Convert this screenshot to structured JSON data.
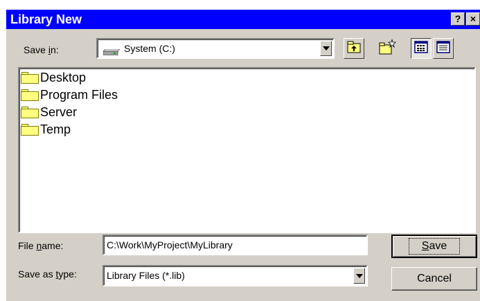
{
  "window": {
    "title": "Library New",
    "help_label": "?",
    "close_label": "×"
  },
  "save_in": {
    "label_pre": "Save ",
    "label_key": "i",
    "label_post": "n:",
    "value": "System (C:)",
    "icon": "hard-drive-icon"
  },
  "toolbar": {
    "icons": [
      "up-one-level-icon",
      "create-new-folder-icon",
      "list-view-icon",
      "details-view-icon"
    ]
  },
  "files": [
    {
      "name": "Desktop",
      "icon": "folder-icon"
    },
    {
      "name": "Program Files",
      "icon": "folder-icon"
    },
    {
      "name": "Server",
      "icon": "folder-icon"
    },
    {
      "name": "Temp",
      "icon": "folder-icon"
    }
  ],
  "file_name": {
    "label_pre": "File ",
    "label_key": "n",
    "label_post": "ame:",
    "value": "C:\\Work\\MyProject\\MyLibrary"
  },
  "save_as_type": {
    "label_pre": "Save as ",
    "label_key": "t",
    "label_post": "ype:",
    "value": "Library Files (*.lib)"
  },
  "buttons": {
    "save_key": "S",
    "save_rest": "ave",
    "cancel": "Cancel"
  },
  "colors": {
    "titlebar": "#0000ff",
    "dialog": "#d4d0c8",
    "folder": "#ffff80"
  }
}
